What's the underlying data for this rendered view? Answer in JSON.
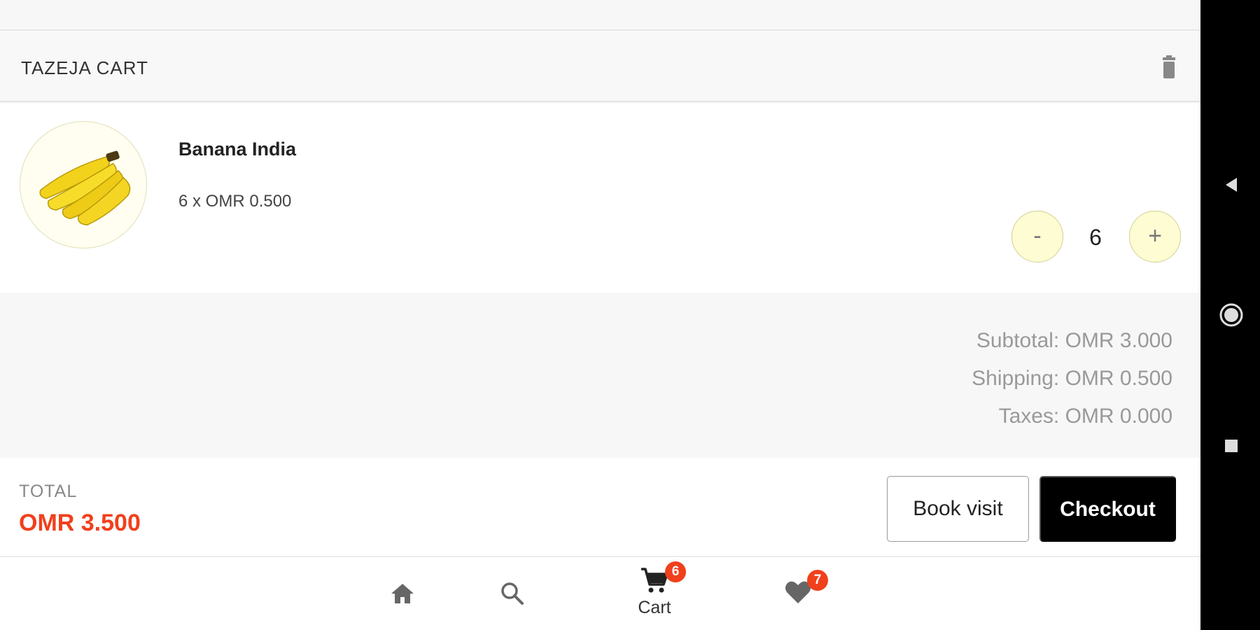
{
  "cart": {
    "title": "TAZEJA CART",
    "trash_icon": "trash-icon"
  },
  "item": {
    "name": "Banana India",
    "price_line": "6 x OMR 0.500",
    "quantity": "6",
    "minus_label": "-",
    "plus_label": "+",
    "image": "banana-bunch-image"
  },
  "summary": {
    "subtotal": "Subtotal: OMR 3.000",
    "shipping": "Shipping: OMR 0.500",
    "taxes": "Taxes: OMR 0.000"
  },
  "total": {
    "label": "TOTAL",
    "value": "OMR 3.500",
    "book_visit_label": "Book visit",
    "checkout_label": "Checkout"
  },
  "nav": {
    "home_icon": "home-icon",
    "search_icon": "search-icon",
    "cart_label": "Cart",
    "cart_badge": "6",
    "wishlist_badge": "7"
  },
  "colors": {
    "accent": "#f0401c",
    "qty_button_bg": "#fdfcd2",
    "checkout_bg": "#000000"
  }
}
